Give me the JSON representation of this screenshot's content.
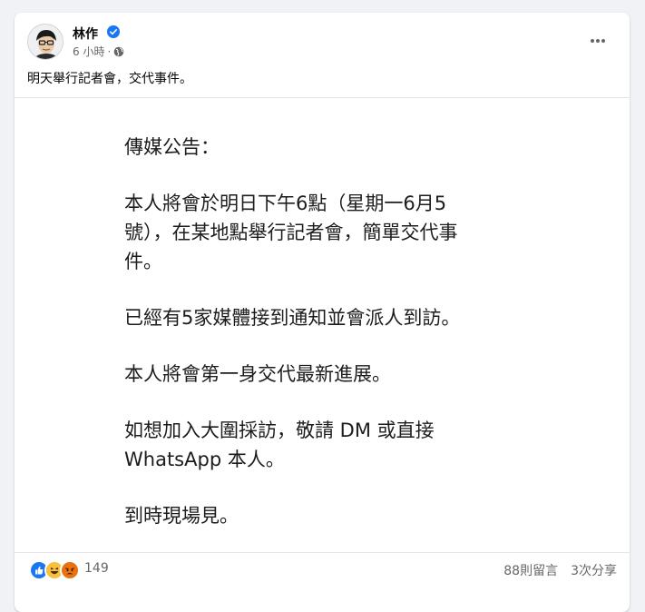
{
  "post": {
    "author": "林作",
    "time": "6 小時",
    "separator": "·",
    "caption": "明天舉行記者會，交代事件。"
  },
  "notice": {
    "heading": "傳媒公告：",
    "line1": "本人將會於明日下午6點（星期一6月5",
    "line2": "號），在某地點舉行記者會，簡單交代事",
    "line3": "件。",
    "line4": "已經有5家媒體接到通知並會派人到訪。",
    "line5": "本人將會第一身交代最新進展。",
    "line6": "如想加入大圍採訪，敬請 DM 或直接",
    "line7": "WhatsApp 本人。",
    "line8": "到時現場見。"
  },
  "footer": {
    "reaction_count": "149",
    "comments": "88則留言",
    "shares": "3次分享"
  },
  "icons": {
    "verified": "verified-badge-icon",
    "audience": "globe-icon",
    "more": "more-options-icon",
    "reactions": [
      "like-icon",
      "haha-icon",
      "angry-icon"
    ]
  },
  "colors": {
    "accent": "#1877f2",
    "secondary_text": "#65676b"
  }
}
